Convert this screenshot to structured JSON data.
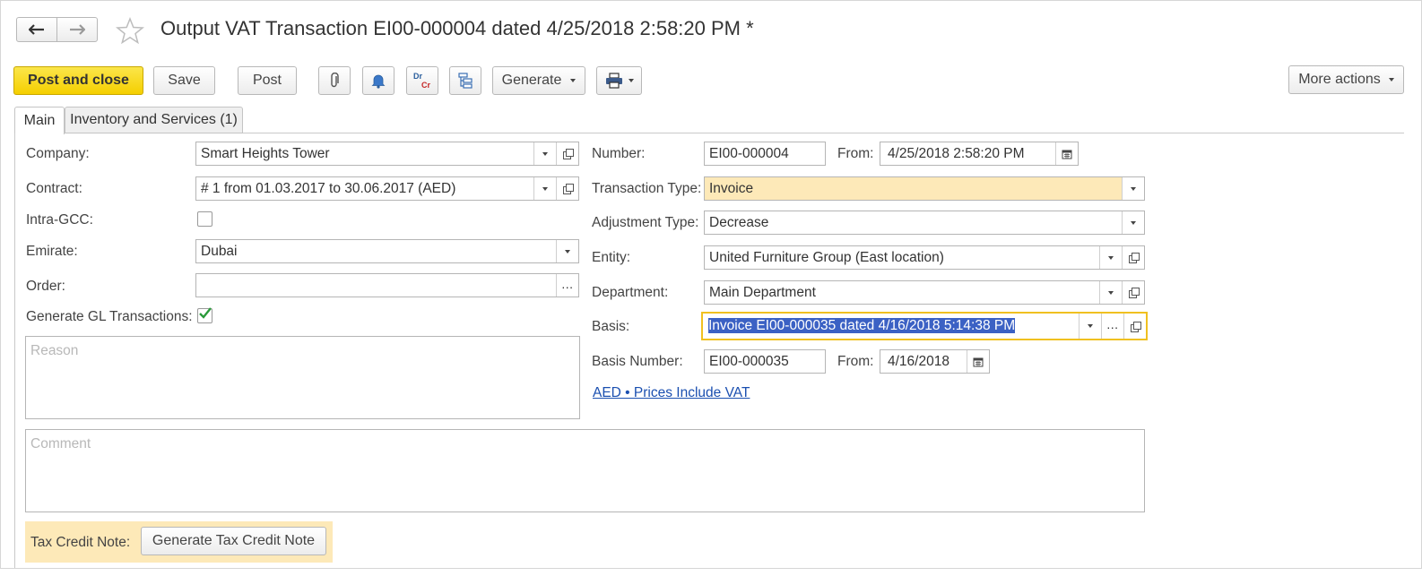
{
  "window": {
    "title": "Output VAT Transaction EI00-000004 dated 4/25/2018 2:58:20 PM *"
  },
  "toolbar": {
    "post_and_close": "Post and close",
    "save": "Save",
    "post": "Post",
    "dr_label": "Dr",
    "cr_label": "Cr",
    "generate": "Generate",
    "more_actions": "More actions"
  },
  "tabs": [
    {
      "label": "Main",
      "active": true
    },
    {
      "label": "Inventory and Services (1)",
      "active": false
    }
  ],
  "left": {
    "company_label": "Company:",
    "company_value": "Smart Heights Tower",
    "contract_label": "Contract:",
    "contract_value": "# 1 from 01.03.2017 to 30.06.2017 (AED)",
    "intra_gcc_label": "Intra-GCC:",
    "intra_gcc_checked": false,
    "emirate_label": "Emirate:",
    "emirate_value": "Dubai",
    "order_label": "Order:",
    "order_value": "",
    "gen_gl_label": "Generate GL Transactions:",
    "gen_gl_checked": true,
    "reason_placeholder": "Reason"
  },
  "right": {
    "number_label": "Number:",
    "number_value": "EI00-000004",
    "from_label": "From:",
    "from_value": "4/25/2018  2:58:20 PM",
    "transaction_type_label": "Transaction Type:",
    "transaction_type_value": "Invoice",
    "adjustment_type_label": "Adjustment Type:",
    "adjustment_type_value": "Decrease",
    "entity_label": "Entity:",
    "entity_value": "United Furniture Group (East location)",
    "department_label": "Department:",
    "department_value": "Main Department",
    "basis_label": "Basis:",
    "basis_value": "Invoice EI00-000035 dated 4/16/2018 5:14:38 PM",
    "basis_number_label": "Basis Number:",
    "basis_number_value": "EI00-000035",
    "basis_from_label": "From:",
    "basis_from_value": "4/16/2018",
    "currency_link": "AED • Prices Include VAT"
  },
  "comment_placeholder": "Comment",
  "tax_credit": {
    "label": "Tax Credit Note:",
    "button": "Generate Tax Credit Note"
  },
  "colors": {
    "primary_button": "#f5d400",
    "highlight_field": "#fde9b8",
    "focus_border": "#f0c020",
    "selection": "#3b61c4",
    "link": "#1a4fb0",
    "checkmark": "#2a9a3a"
  }
}
